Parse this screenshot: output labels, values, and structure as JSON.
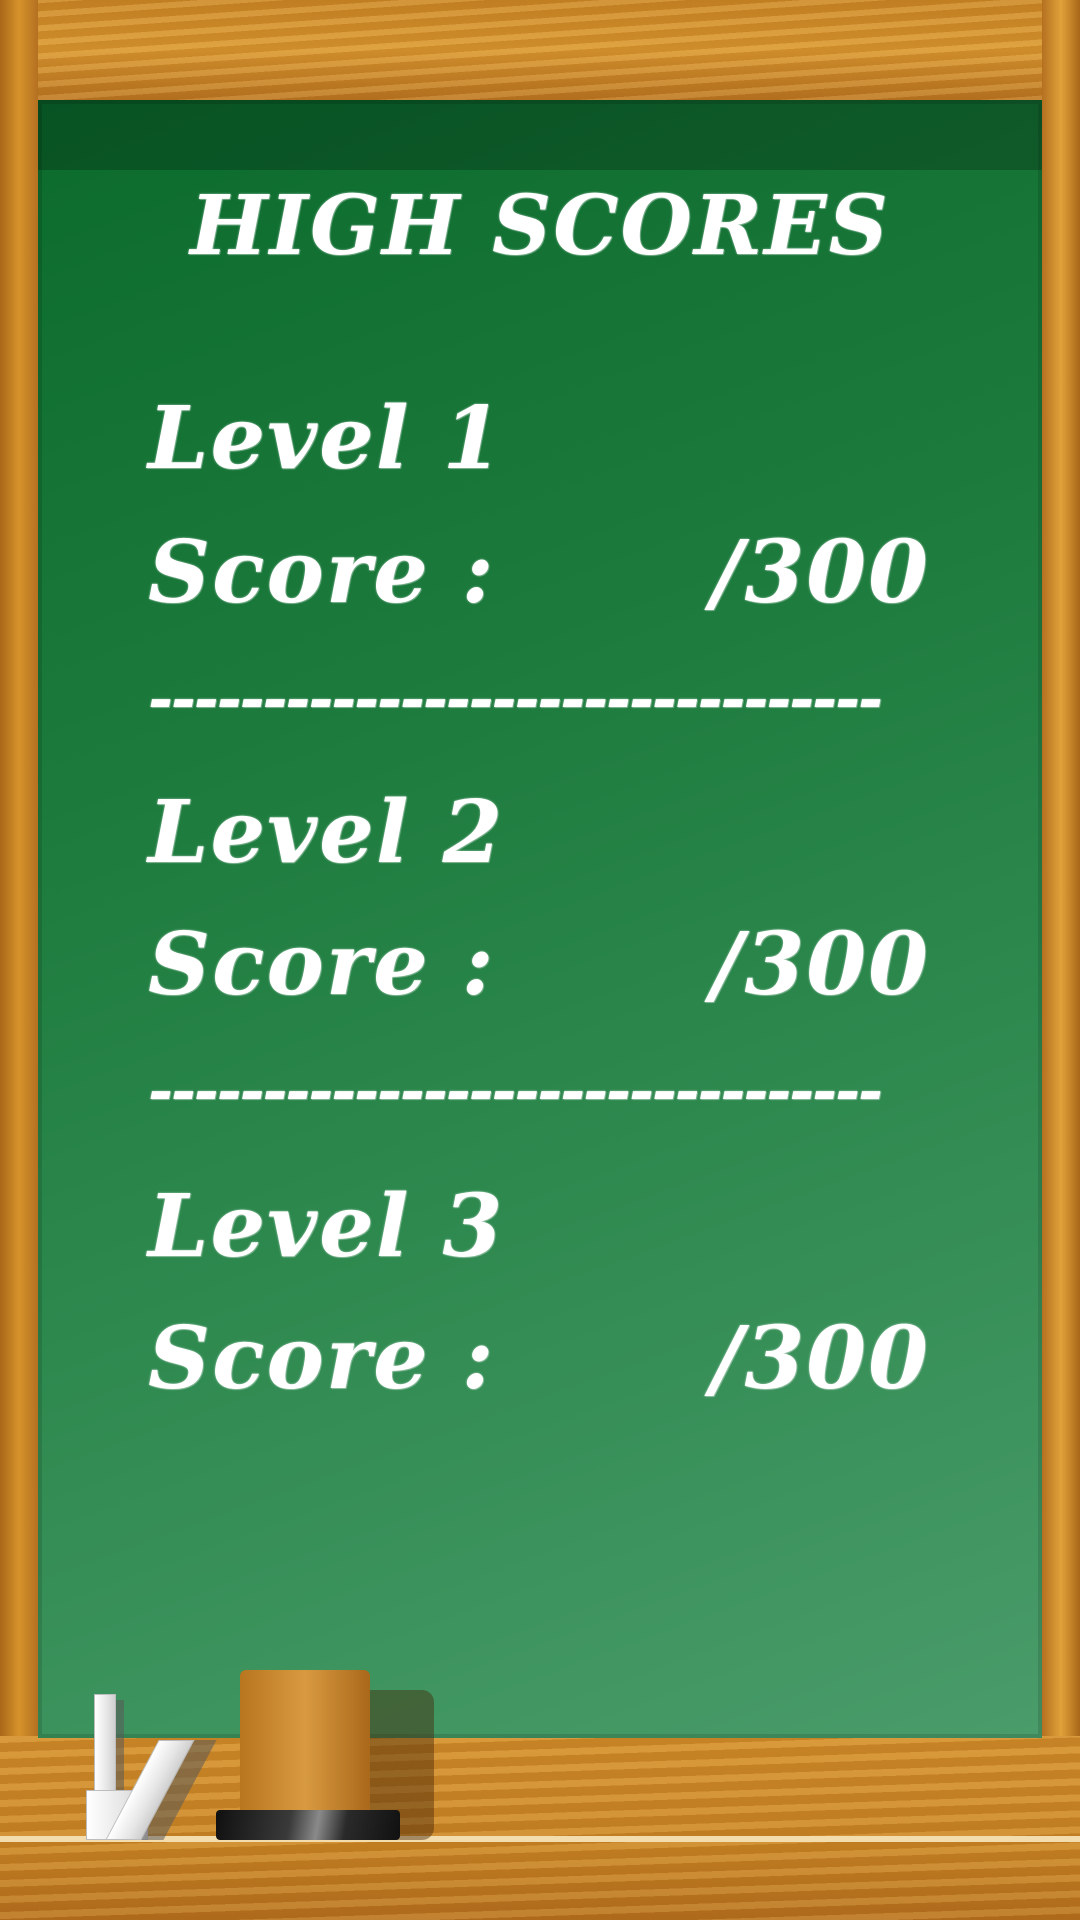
{
  "title": "HIGH SCORES",
  "levels": [
    {
      "label": "Level 1",
      "score_label": "Score :",
      "score_value": "/300"
    },
    {
      "label": "Level 2",
      "score_label": "Score :",
      "score_value": "/300"
    },
    {
      "label": "Level 3",
      "score_label": "Score :",
      "score_value": "/300"
    }
  ],
  "divider": "--------------------------------",
  "colors": {
    "board": "#1c7a3c",
    "wood": "#c98625",
    "chalk": "#ffffff"
  },
  "icons": [
    "chalk-icon",
    "eraser-icon"
  ]
}
